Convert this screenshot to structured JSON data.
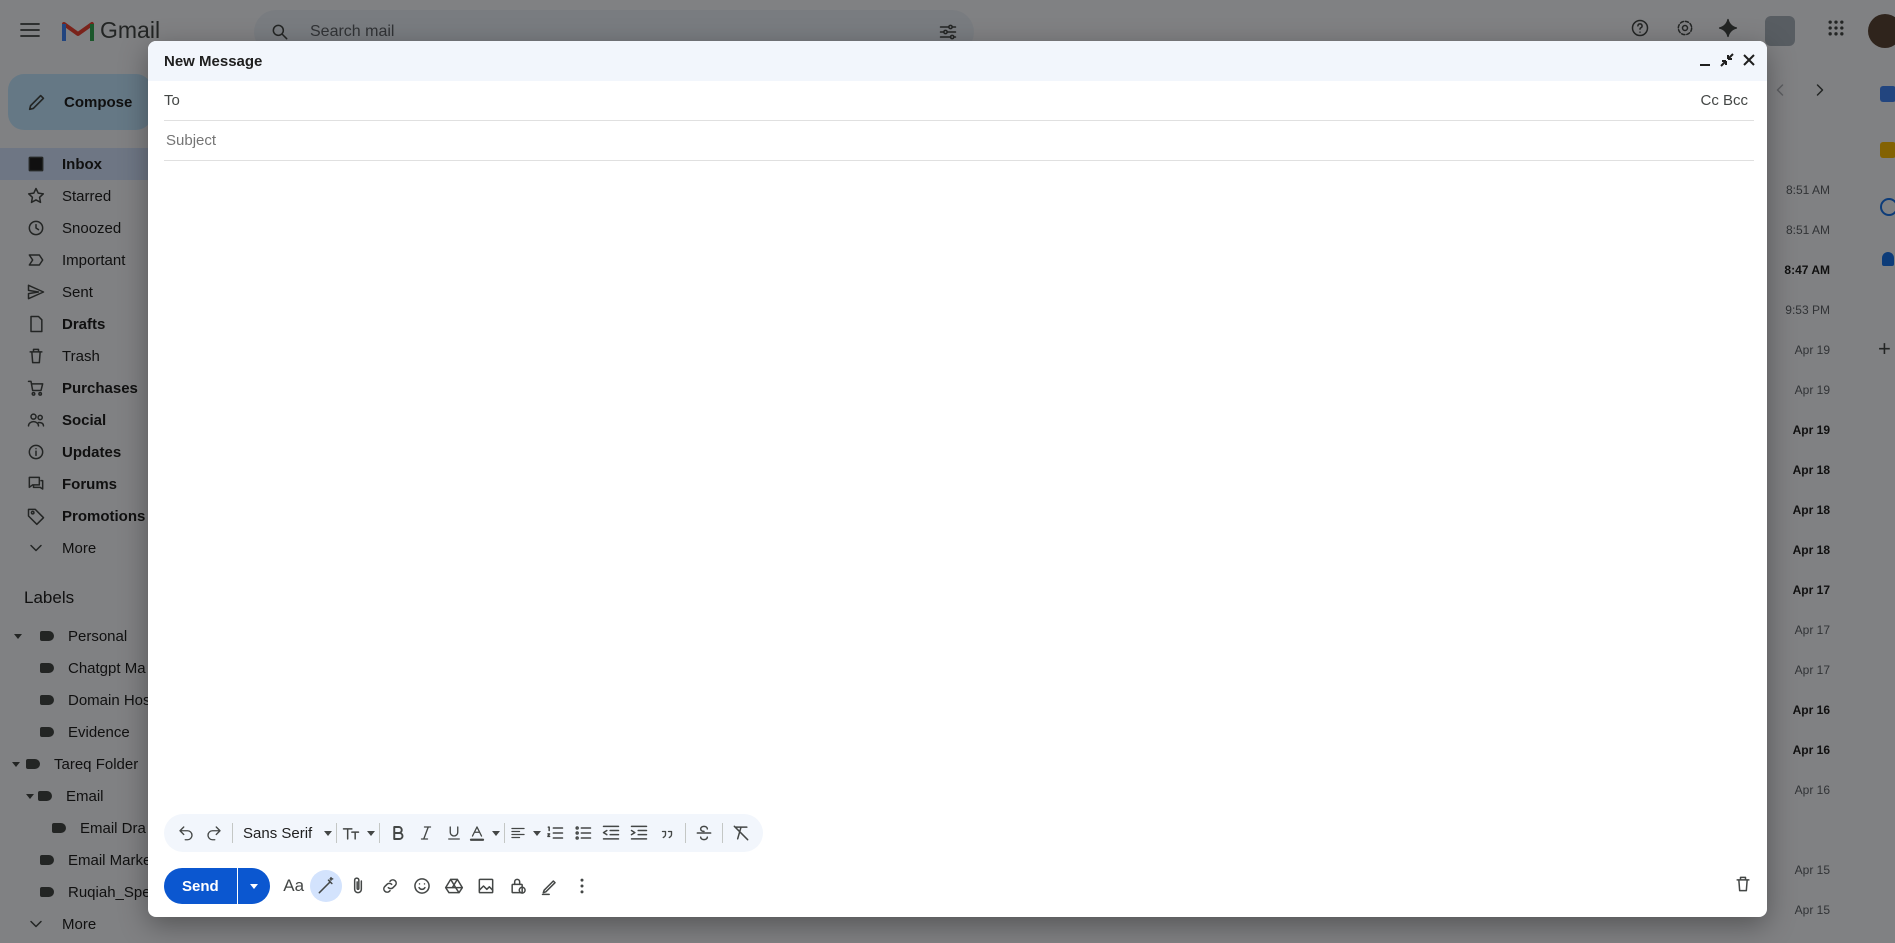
{
  "app": {
    "name": "Gmail"
  },
  "search": {
    "placeholder": "Search mail"
  },
  "compose_button": {
    "label": "Compose"
  },
  "sidebar": {
    "items": [
      {
        "label": "Inbox",
        "icon": "inbox-icon",
        "active": true
      },
      {
        "label": "Starred",
        "icon": "star-icon"
      },
      {
        "label": "Snoozed",
        "icon": "clock-icon"
      },
      {
        "label": "Important",
        "icon": "important-icon"
      },
      {
        "label": "Sent",
        "icon": "send-icon"
      },
      {
        "label": "Drafts",
        "icon": "draft-icon",
        "bold": true
      },
      {
        "label": "Trash",
        "icon": "trash-icon"
      },
      {
        "label": "Purchases",
        "icon": "cart-icon",
        "bold": true
      },
      {
        "label": "Social",
        "icon": "people-icon",
        "bold": true
      },
      {
        "label": "Updates",
        "icon": "info-icon",
        "bold": true
      },
      {
        "label": "Forums",
        "icon": "forum-icon",
        "bold": true
      },
      {
        "label": "Promotions",
        "icon": "tag-icon",
        "bold": true
      },
      {
        "label": "More",
        "icon": "chevron-down-icon"
      }
    ]
  },
  "labels": {
    "title": "Labels",
    "items": [
      {
        "label": "Personal"
      },
      {
        "label": "Chatgpt Ma"
      },
      {
        "label": "Domain Hos"
      },
      {
        "label": "Evidence"
      },
      {
        "label": "Tareq Folder"
      },
      {
        "label": "Email"
      },
      {
        "label": "Email Dra"
      },
      {
        "label": "Email Marke"
      },
      {
        "label": "Ruqiah_Spe"
      },
      {
        "label": "More"
      }
    ]
  },
  "message_times": [
    {
      "t": "8:51 AM",
      "bold": false
    },
    {
      "t": "8:51 AM",
      "bold": false
    },
    {
      "t": "8:47 AM",
      "bold": true
    },
    {
      "t": "9:53 PM",
      "bold": false
    },
    {
      "t": "Apr 19",
      "bold": false
    },
    {
      "t": "Apr 19",
      "bold": false
    },
    {
      "t": "Apr 19",
      "bold": true
    },
    {
      "t": "Apr 18",
      "bold": true
    },
    {
      "t": "Apr 18",
      "bold": true
    },
    {
      "t": "Apr 18",
      "bold": true
    },
    {
      "t": "Apr 17",
      "bold": true
    },
    {
      "t": "Apr 17",
      "bold": false
    },
    {
      "t": "Apr 17",
      "bold": false
    },
    {
      "t": "Apr 16",
      "bold": true
    },
    {
      "t": "Apr 16",
      "bold": true
    },
    {
      "t": "Apr 16",
      "bold": false
    },
    {
      "t": "",
      "bold": false
    },
    {
      "t": "Apr 15",
      "bold": false
    },
    {
      "t": "Apr 15",
      "bold": false
    }
  ],
  "compose": {
    "title": "New Message",
    "to_label": "To",
    "to_value": "",
    "cc_bcc": "Cc Bcc",
    "subject_placeholder": "Subject",
    "subject_value": "",
    "font_name": "Sans Serif",
    "send_label": "Send"
  },
  "colors": {
    "accent": "#0b57d0",
    "compose_bg": "#c2e7ff",
    "active_nav": "#d3e3fd"
  }
}
